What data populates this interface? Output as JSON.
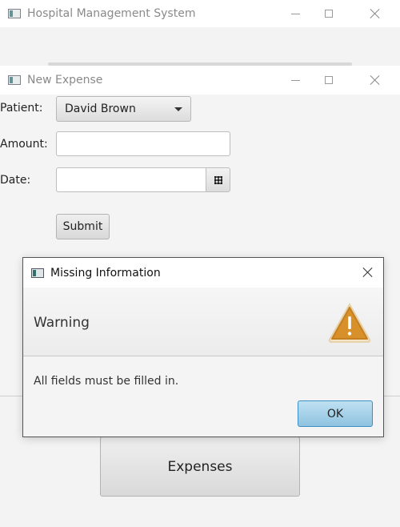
{
  "main_window": {
    "title": "Hospital Management System",
    "expenses_button_label": "Expenses"
  },
  "expense_window": {
    "title": "New Expense",
    "patient_label": "Patient:",
    "patient_selected": "David Brown",
    "amount_label": "Amount:",
    "amount_value": "",
    "date_label": "Date:",
    "date_value": "",
    "submit_label": "Submit"
  },
  "dialog": {
    "title": "Missing Information",
    "header": "Warning",
    "message": "All fields must be filled in.",
    "ok_label": "OK",
    "accent_color": "#d8902a",
    "button_color": "#9ccbe6"
  }
}
